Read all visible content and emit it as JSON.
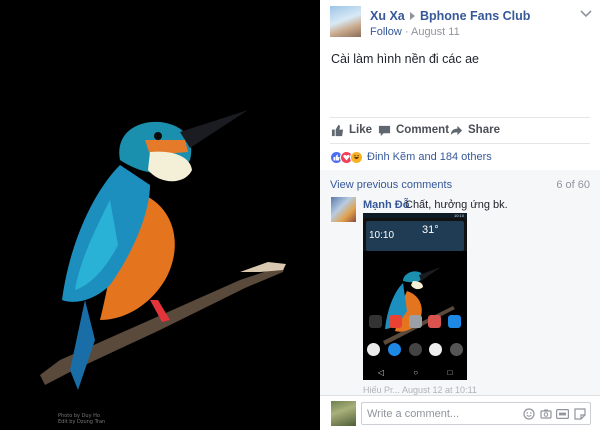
{
  "photo": {
    "credit_line1": "Photo by Duy Ho",
    "credit_line2": "Edit by Dzung Tran"
  },
  "post": {
    "author": "Xu Xa",
    "group": "Bphone Fans Club",
    "follow_label": "Follow",
    "separator": "·",
    "date": "August 11",
    "text": "Cài làm hình nền đi các ae"
  },
  "actions": {
    "like": "Like",
    "comment": "Comment",
    "share": "Share"
  },
  "reactions": {
    "summary": "Đinh Kẽm and 184 others",
    "types": [
      "like",
      "love",
      "haha"
    ]
  },
  "comments": {
    "view_previous": "View previous comments",
    "count": "6 of 60",
    "first": {
      "author": "Mạnh Đỗ",
      "text": "Chất, hưởng ứng bk.",
      "screenshot": {
        "clock": "10:10",
        "temp": "31°",
        "status_time": "10:10"
      }
    },
    "next_preview": "Hiếu Pr... August 12 at 10:11"
  },
  "composer": {
    "placeholder": "Write a comment..."
  },
  "colors": {
    "link": "#365899",
    "muted": "#90949c",
    "like_blue": "#4c6ef5",
    "love_red": "#f33e58"
  }
}
